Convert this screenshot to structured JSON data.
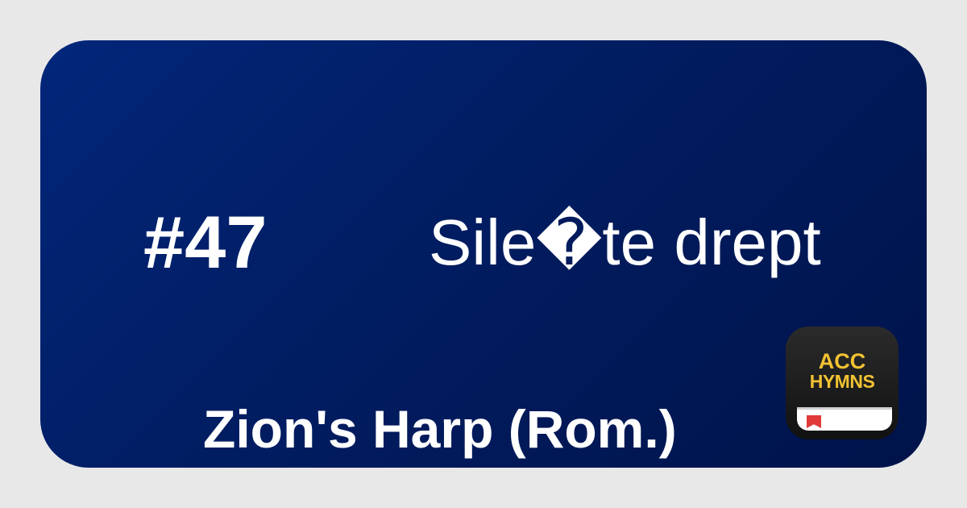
{
  "hymn": {
    "number": "#47",
    "title": "Sile�te drept",
    "book": "Zion's Harp (Rom.)"
  },
  "logo": {
    "line1": "ACC",
    "line2": "HYMNS",
    "icon": "book-icon"
  },
  "colors": {
    "frame": "#e8e8e8",
    "card_start": "#02267a",
    "card_end": "#00134a",
    "text": "#ffffff",
    "logo_text": "#f1c232",
    "logo_bg": "#1a1a1a",
    "bookmark": "#e03a3a"
  }
}
